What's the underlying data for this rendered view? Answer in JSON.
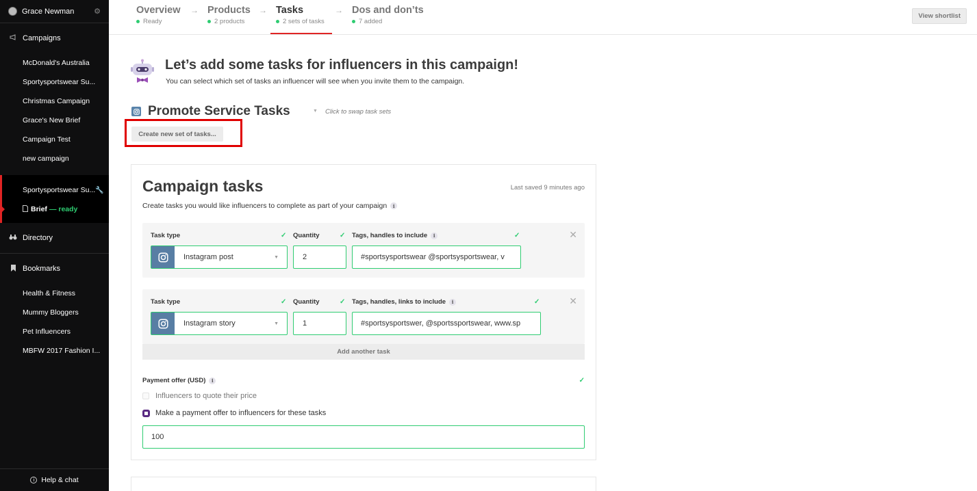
{
  "sidebar": {
    "user_name": "Grace Newman",
    "campaigns_label": "Campaigns",
    "campaigns": [
      "McDonald's Australia",
      "Sportysportswear Su...",
      "Christmas Campaign",
      "Grace's New Brief",
      "Campaign Test",
      "new campaign"
    ],
    "active_campaign": "Sportysportswear Su...",
    "brief_label": "Brief",
    "brief_status": "— ready",
    "directory_label": "Directory",
    "bookmarks_label": "Bookmarks",
    "bookmarks": [
      "Health & Fitness",
      "Mummy Bloggers",
      "Pet Influencers",
      "MBFW 2017 Fashion I..."
    ],
    "help_label": "Help & chat"
  },
  "nav": {
    "steps": [
      {
        "name": "Overview",
        "sub": "Ready"
      },
      {
        "name": "Products",
        "sub": "2 products"
      },
      {
        "name": "Tasks",
        "sub": "2 sets of tasks"
      },
      {
        "name": "Dos and don’ts",
        "sub": "7 added"
      }
    ],
    "shortlist_label": "View shortlist"
  },
  "main": {
    "heading": "Let’s add some tasks for influencers in this campaign!",
    "intro": "You can select which set of tasks an influencer will see when you invite them to the campaign.",
    "task_set_title": "Promote Service Tasks",
    "swap_hint": "Click to swap task sets",
    "create_button": "Create new set of tasks..."
  },
  "card": {
    "title": "Campaign tasks",
    "last_saved": "Last saved 9 minutes ago",
    "description": "Create tasks you would like influencers to complete as part of your campaign",
    "task_type_label": "Task type",
    "quantity_label": "Quantity",
    "tasks": [
      {
        "tags_label": "Tags, handles to include",
        "type": "Instagram post",
        "quantity": "2",
        "tags": "#sportsysportswear @sportsysportswear, v"
      },
      {
        "tags_label": "Tags, handles, links to include",
        "type": "Instagram story",
        "quantity": "1",
        "tags": "#sportsysportswer, @sportssportswear, www.sp"
      }
    ],
    "add_task": "Add another task",
    "payment_label": "Payment offer (USD)",
    "option_quote": "Influencers to quote their price",
    "option_offer": "Make a payment offer to influencers for these tasks",
    "amount": "100"
  },
  "colors": {
    "accent_red": "#e02424",
    "success_green": "#2ecc71",
    "instagram_blue": "#587ea4",
    "radio_purple": "#5a2a82"
  }
}
